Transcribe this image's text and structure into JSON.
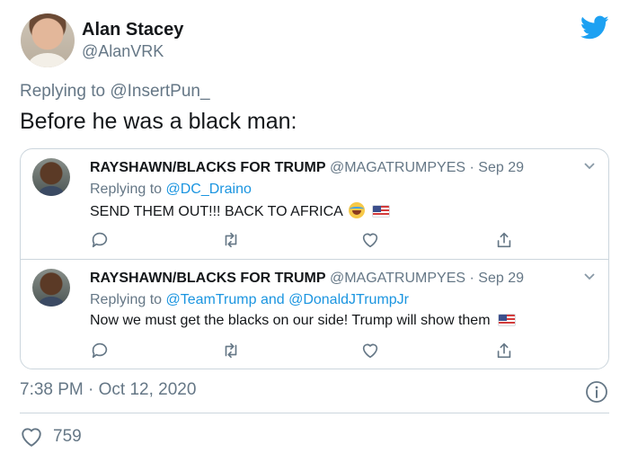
{
  "author": {
    "name": "Alan Stacey",
    "handle": "@AlanVRK"
  },
  "reply_context": {
    "prefix": "Replying to",
    "mention": "@InsertPun_"
  },
  "text": "Before he was a black man:",
  "embedded": [
    {
      "name": "RAYSHAWN/BLACKS FOR TRUMP",
      "meta": "@MAGATRUMPYES · Sep 29",
      "reply_prefix": "Replying to",
      "reply_to": "@DC_Draino",
      "text": "SEND THEM OUT!!! BACK TO AFRICA"
    },
    {
      "name": "RAYSHAWN/BLACKS FOR TRUMP",
      "meta": "@MAGATRUMPYES · Sep 29",
      "reply_prefix": "Replying to",
      "reply_to": "@TeamTrump and @DonaldJTrumpJr",
      "text": "Now we must get the blacks on our side! Trump will show them"
    }
  ],
  "timestamp": "7:38 PM · Oct 12, 2020",
  "likes": "759",
  "colors": {
    "accent": "#1da1f2",
    "link": "#1b95e0",
    "secondary": "#657786",
    "border": "#ccd6dd"
  },
  "icons": [
    "twitter-bird-icon",
    "chevron-down-icon",
    "reply-icon",
    "retweet-icon",
    "heart-icon",
    "share-icon",
    "info-icon",
    "laughing-emoji",
    "us-flag-emoji"
  ]
}
